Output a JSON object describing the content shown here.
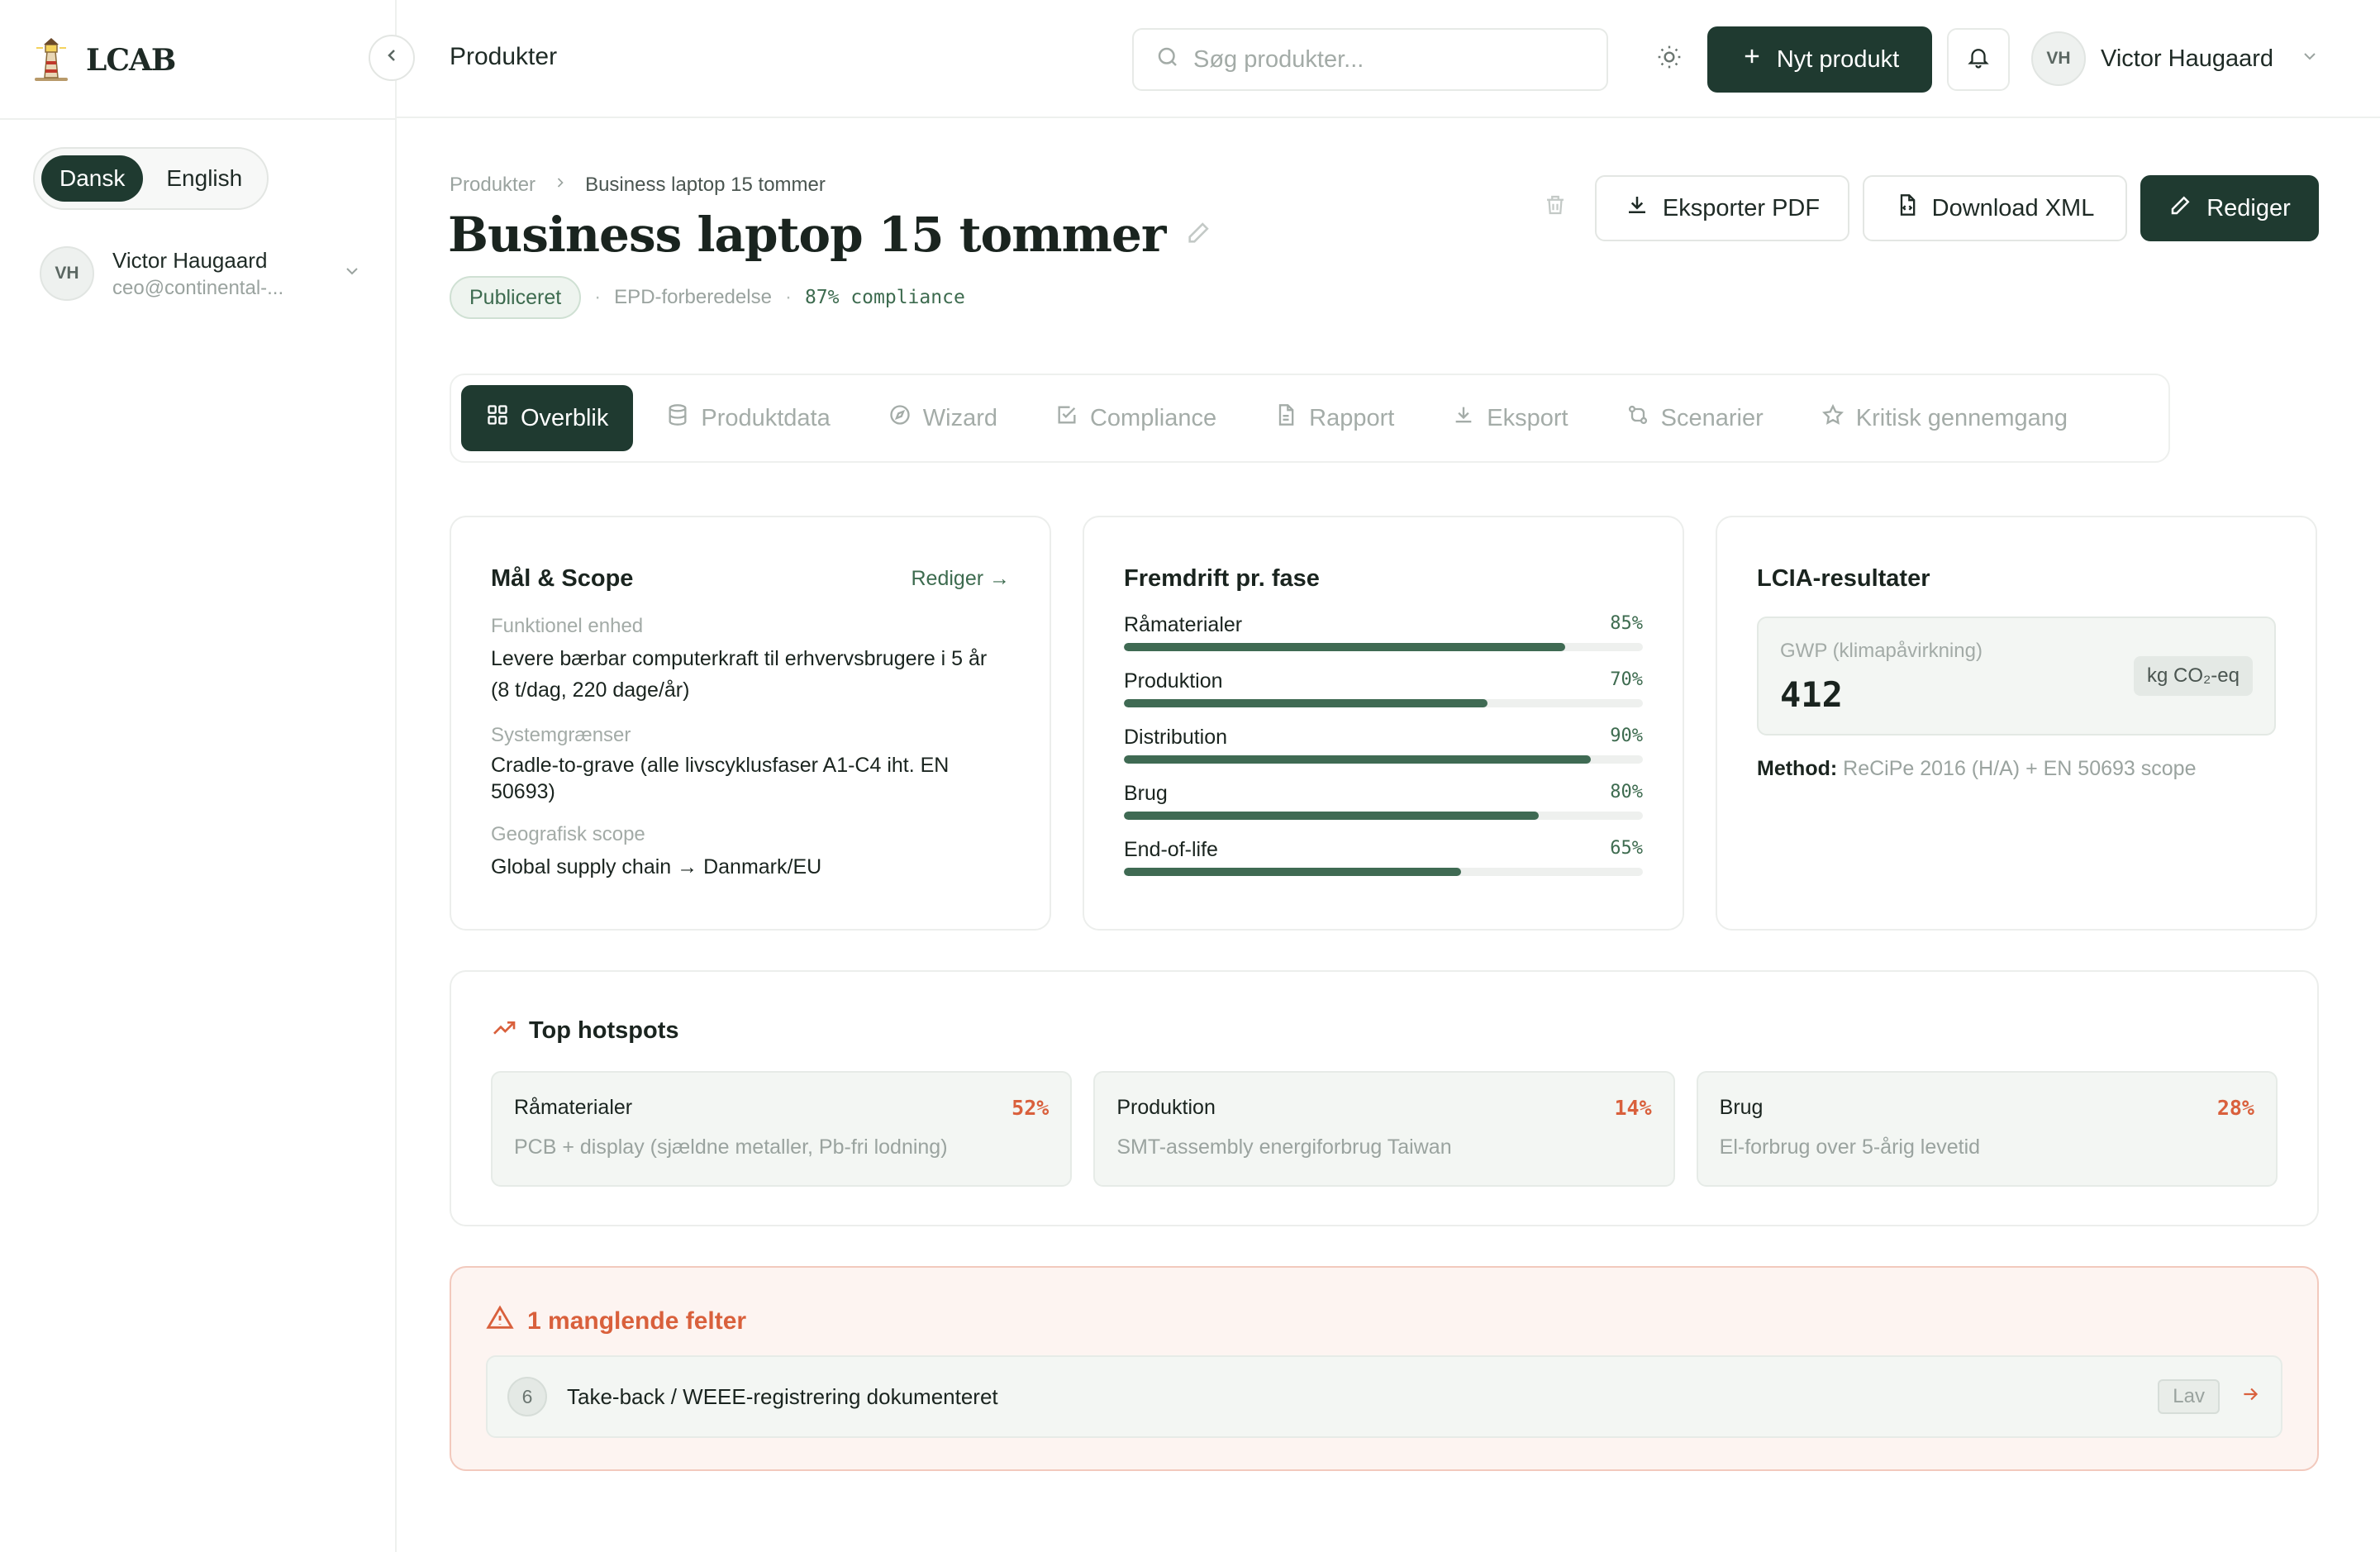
{
  "app": {
    "brand": "LCAB",
    "languages": [
      {
        "label": "Dansk",
        "active": true
      },
      {
        "label": "English",
        "active": false
      }
    ],
    "user": {
      "initials": "VH",
      "name": "Victor Haugaard",
      "email": "ceo@continental-..."
    }
  },
  "topbar": {
    "title": "Produkter",
    "search_placeholder": "Søg produkter...",
    "new_button": "Nyt produkt",
    "user_initials": "VH",
    "user_name": "Victor Haugaard"
  },
  "header": {
    "breadcrumb": [
      "Produkter",
      "Business laptop 15 tommer"
    ],
    "title": "Business laptop 15 tommer",
    "status": "Publiceret",
    "stage": "EPD-forberedelse",
    "compliance": "87% compliance",
    "actions": {
      "export_pdf": "Eksporter PDF",
      "download_xml": "Download XML",
      "edit": "Rediger"
    }
  },
  "tabs": [
    {
      "label": "Overblik",
      "icon": "grid-icon",
      "active": true
    },
    {
      "label": "Produktdata",
      "icon": "database-icon"
    },
    {
      "label": "Wizard",
      "icon": "compass-icon"
    },
    {
      "label": "Compliance",
      "icon": "checkbox-icon"
    },
    {
      "label": "Rapport",
      "icon": "file-text-icon"
    },
    {
      "label": "Eksport",
      "icon": "download-icon"
    },
    {
      "label": "Scenarier",
      "icon": "git-compare-icon"
    },
    {
      "label": "Kritisk gennemgang",
      "icon": "star-icon"
    }
  ],
  "scope": {
    "title": "Mål & Scope",
    "edit_link": "Rediger →",
    "fields": [
      {
        "label": "Funktionel enhed",
        "value": "Levere bærbar computerkraft til erhvervsbrugere i 5 år (8 t/dag, 220 dage/år)"
      },
      {
        "label": "Systemgrænser",
        "value": "Cradle-to-grave (alle livscyklusfaser A1-C4 iht. EN 50693)"
      },
      {
        "label": "Geografisk scope",
        "value": "Global supply chain → Danmark/EU"
      }
    ]
  },
  "phases": {
    "title": "Fremdrift pr. fase",
    "items": [
      {
        "name": "Råmaterialer",
        "pct_label": "85%",
        "value": 0.85
      },
      {
        "name": "Produktion",
        "pct_label": "70%",
        "value": 0.7
      },
      {
        "name": "Distribution",
        "pct_label": "90%",
        "value": 0.9
      },
      {
        "name": "Brug",
        "pct_label": "80%",
        "value": 0.8
      },
      {
        "name": "End-of-life",
        "pct_label": "65%",
        "value": 0.65
      }
    ]
  },
  "lcia": {
    "title": "LCIA-resultater",
    "gwp_label": "GWP (klimapåvirkning)",
    "gwp_value": "412",
    "unit": "kg CO₂-eq",
    "method_label": "Method:",
    "method_value": "ReCiPe 2016 (H/A) + EN 50693 scope"
  },
  "hotspots": {
    "title": "Top hotspots",
    "items": [
      {
        "name": "Råmaterialer",
        "pct": "52%",
        "desc": "PCB + display (sjældne metaller, Pb-fri lodning)"
      },
      {
        "name": "Produktion",
        "pct": "14%",
        "desc": "SMT-assembly energiforbrug Taiwan"
      },
      {
        "name": "Brug",
        "pct": "28%",
        "desc": "El-forbrug over 5-årig levetid"
      }
    ]
  },
  "missing": {
    "title": "1 manglende felter",
    "items": [
      {
        "number": "6",
        "text": "Take-back / WEEE-registrering dokumenteret",
        "priority": "Lav"
      }
    ]
  },
  "colors": {
    "primary": "#1f3a30",
    "accent_green": "#3d6b4f",
    "warning": "#d9603c"
  }
}
